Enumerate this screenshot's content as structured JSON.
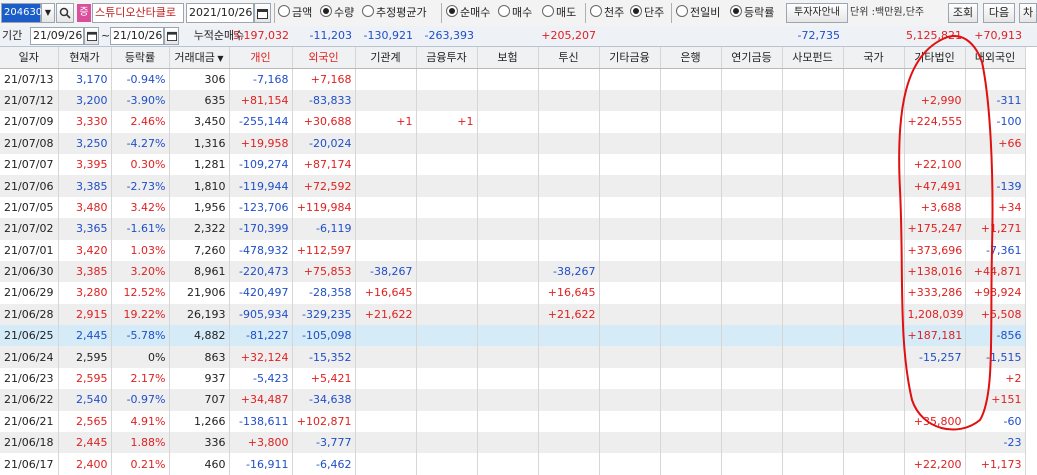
{
  "toolbar": {
    "stock_code": "204630",
    "stock_name": "스튜디오산타클로",
    "date": "2021/10/26",
    "options_group1": [
      {
        "label": "금액",
        "checked": false
      },
      {
        "label": "수량",
        "checked": true
      },
      {
        "label": "추정평균가",
        "checked": false
      }
    ],
    "options_group2": [
      {
        "label": "순매수",
        "checked": true
      },
      {
        "label": "매수",
        "checked": false
      },
      {
        "label": "매도",
        "checked": false
      }
    ],
    "options_group3": [
      {
        "label": "천주",
        "checked": false
      },
      {
        "label": "단주",
        "checked": true
      }
    ],
    "options_group4": [
      {
        "label": "전일비",
        "checked": false
      },
      {
        "label": "등락률",
        "checked": true
      }
    ],
    "investor_guide": "투자자안내",
    "unit": "단위 :백만원,단주",
    "search_button": "조회",
    "next_button": "다음",
    "chart_button": "차"
  },
  "period": {
    "label": "기간",
    "start": "21/09/26",
    "tilde": "~",
    "end": "21/10/26",
    "cumulative_label": "누적순매수",
    "totals": [
      "5,197,032",
      "-11,203",
      "-130,921",
      "-263,393",
      "",
      "+205,207",
      "",
      "",
      "",
      "-72,735",
      "",
      "5,125,821",
      "+70,913"
    ]
  },
  "table": {
    "headers": [
      "일자",
      "현재가",
      "등락률",
      "거래대금",
      "개인",
      "외국인",
      "기관계",
      "금융투자",
      "보험",
      "투신",
      "기타금융",
      "은행",
      "연기금등",
      "사모펀드",
      "국가",
      "기타법인",
      "내외국인"
    ],
    "sort_arrow": "▼",
    "rows": [
      [
        "21/07/13",
        "3,170",
        "-0.94%",
        "306",
        "-7,168",
        "+7,168",
        "",
        "",
        "",
        "",
        "",
        "",
        "",
        "",
        "",
        "",
        ""
      ],
      [
        "21/07/12",
        "3,200",
        "-3.90%",
        "635",
        "+81,154",
        "-83,833",
        "",
        "",
        "",
        "",
        "",
        "",
        "",
        "",
        "",
        "+2,990",
        "-311"
      ],
      [
        "21/07/09",
        "3,330",
        "2.46%",
        "3,450",
        "-255,144",
        "+30,688",
        "+1",
        "+1",
        "",
        "",
        "",
        "",
        "",
        "",
        "",
        "+224,555",
        "-100"
      ],
      [
        "21/07/08",
        "3,250",
        "-4.27%",
        "1,316",
        "+19,958",
        "-20,024",
        "",
        "",
        "",
        "",
        "",
        "",
        "",
        "",
        "",
        "",
        "+66"
      ],
      [
        "21/07/07",
        "3,395",
        "0.30%",
        "1,281",
        "-109,274",
        "+87,174",
        "",
        "",
        "",
        "",
        "",
        "",
        "",
        "",
        "",
        "+22,100",
        ""
      ],
      [
        "21/07/06",
        "3,385",
        "-2.73%",
        "1,810",
        "-119,944",
        "+72,592",
        "",
        "",
        "",
        "",
        "",
        "",
        "",
        "",
        "",
        "+47,491",
        "-139"
      ],
      [
        "21/07/05",
        "3,480",
        "3.42%",
        "1,956",
        "-123,706",
        "+119,984",
        "",
        "",
        "",
        "",
        "",
        "",
        "",
        "",
        "",
        "+3,688",
        "+34"
      ],
      [
        "21/07/02",
        "3,365",
        "-1.61%",
        "2,322",
        "-170,399",
        "-6,119",
        "",
        "",
        "",
        "",
        "",
        "",
        "",
        "",
        "",
        "+175,247",
        "+1,271"
      ],
      [
        "21/07/01",
        "3,420",
        "1.03%",
        "7,260",
        "-478,932",
        "+112,597",
        "",
        "",
        "",
        "",
        "",
        "",
        "",
        "",
        "",
        "+373,696",
        "-7,361"
      ],
      [
        "21/06/30",
        "3,385",
        "3.20%",
        "8,961",
        "-220,473",
        "+75,853",
        "-38,267",
        "",
        "",
        "-38,267",
        "",
        "",
        "",
        "",
        "",
        "+138,016",
        "+44,871"
      ],
      [
        "21/06/29",
        "3,280",
        "12.52%",
        "21,906",
        "-420,497",
        "-28,358",
        "+16,645",
        "",
        "",
        "+16,645",
        "",
        "",
        "",
        "",
        "",
        "+333,286",
        "+98,924"
      ],
      [
        "21/06/28",
        "2,915",
        "19.22%",
        "26,193",
        "-905,934",
        "-329,235",
        "+21,622",
        "",
        "",
        "+21,622",
        "",
        "",
        "",
        "",
        "",
        "1,208,039",
        "+5,508"
      ],
      [
        "21/06/25",
        "2,445",
        "-5.78%",
        "4,882",
        "-81,227",
        "-105,098",
        "",
        "",
        "",
        "",
        "",
        "",
        "",
        "",
        "",
        "+187,181",
        "-856"
      ],
      [
        "21/06/24",
        "2,595",
        "0%",
        "863",
        "+32,124",
        "-15,352",
        "",
        "",
        "",
        "",
        "",
        "",
        "",
        "",
        "",
        "-15,257",
        "-1,515"
      ],
      [
        "21/06/23",
        "2,595",
        "2.17%",
        "937",
        "-5,423",
        "+5,421",
        "",
        "",
        "",
        "",
        "",
        "",
        "",
        "",
        "",
        "",
        "+2"
      ],
      [
        "21/06/22",
        "2,540",
        "-0.97%",
        "707",
        "+34,487",
        "-34,638",
        "",
        "",
        "",
        "",
        "",
        "",
        "",
        "",
        "",
        "",
        "+151"
      ],
      [
        "21/06/21",
        "2,565",
        "4.91%",
        "1,266",
        "-138,611",
        "+102,871",
        "",
        "",
        "",
        "",
        "",
        "",
        "",
        "",
        "",
        "+35,800",
        "-60"
      ],
      [
        "21/06/18",
        "2,445",
        "1.88%",
        "336",
        "+3,800",
        "-3,777",
        "",
        "",
        "",
        "",
        "",
        "",
        "",
        "",
        "",
        "",
        "-23"
      ],
      [
        "21/06/17",
        "2,400",
        "0.21%",
        "460",
        "-16,911",
        "-6,462",
        "",
        "",
        "",
        "",
        "",
        "",
        "",
        "",
        "",
        "+22,200",
        "+1,173"
      ]
    ]
  },
  "colors": {
    "up": "#e02020",
    "down": "#1f4ec8",
    "highlight_circle": "#e01010",
    "selected_row": "#d5ecf8"
  }
}
